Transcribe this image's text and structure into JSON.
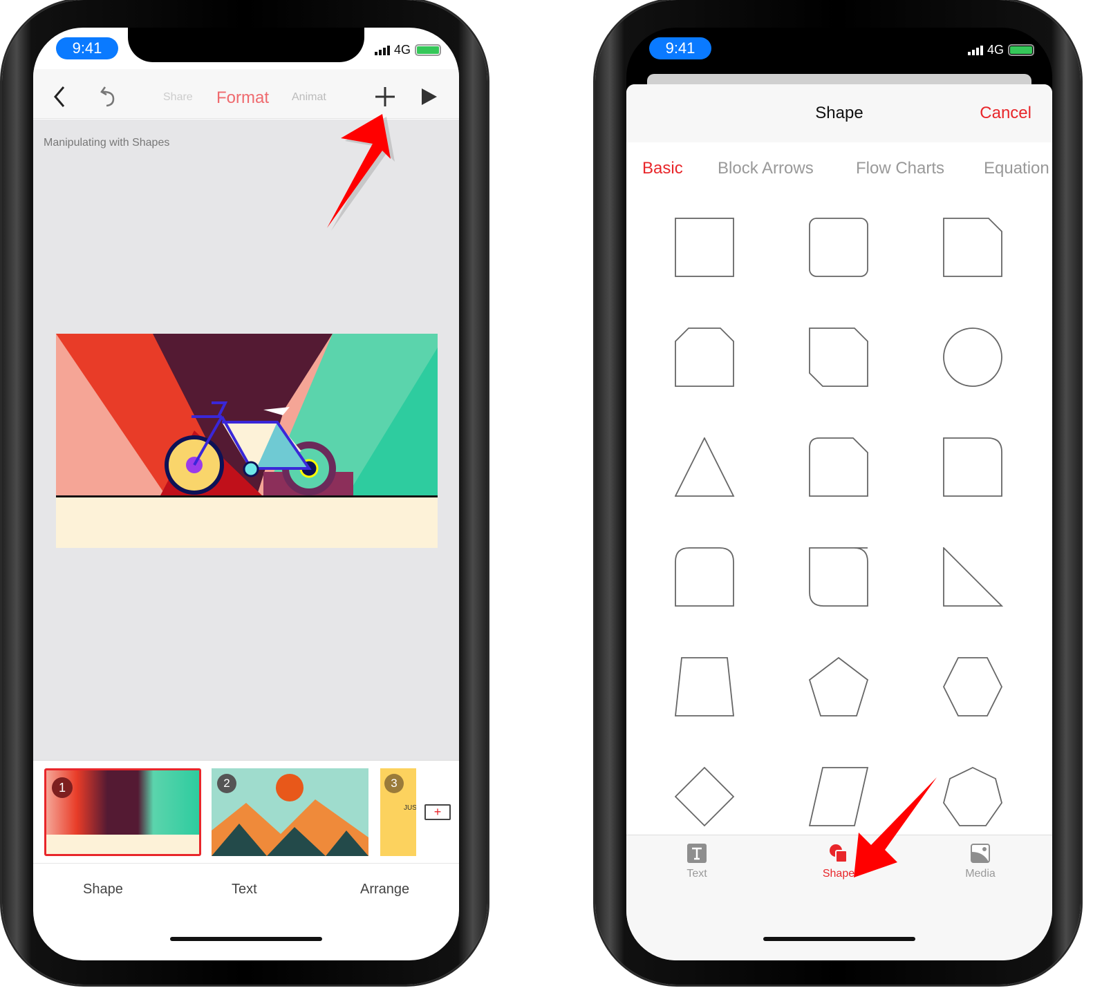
{
  "status": {
    "time": "9:41",
    "network": "4G",
    "battery_percent": 100
  },
  "left": {
    "toolbar": {
      "share": "Share",
      "format": "Format",
      "animate": "Animat",
      "icons": [
        "chevron-left-icon",
        "undo-icon",
        "plus-icon",
        "play-icon"
      ]
    },
    "doc_title": "Manipulating with Shapes",
    "thumbnails": [
      {
        "num": "1"
      },
      {
        "num": "2"
      },
      {
        "num": "3",
        "text": "JUS"
      }
    ],
    "add_slide": "+",
    "bottom": [
      "Shape",
      "Text",
      "Arrange"
    ]
  },
  "right": {
    "sheet_title": "Shape",
    "cancel": "Cancel",
    "categories": [
      "Basic",
      "Block Arrows",
      "Flow Charts",
      "Equation"
    ],
    "selected_category": "Basic",
    "shapes": [
      "rectangle",
      "rounded-rectangle",
      "snip-single-corner",
      "snip-same-side-corners",
      "snip-diagonal-corners",
      "oval",
      "isosceles-triangle",
      "snip-and-round-corner",
      "round-single-corner",
      "round-same-side-corners",
      "round-diagonal-corners",
      "right-triangle",
      "trapezoid",
      "pentagon",
      "hexagon",
      "diamond",
      "parallelogram",
      "heptagon"
    ],
    "tabs": [
      {
        "label": "Text",
        "icon": "text-icon"
      },
      {
        "label": "Shape",
        "icon": "shape-icon",
        "active": true
      },
      {
        "label": "Media",
        "icon": "media-icon"
      }
    ]
  },
  "colors": {
    "accent": "#e8262a",
    "time_pill": "#0a7aff",
    "arrow": "#ff0000"
  }
}
